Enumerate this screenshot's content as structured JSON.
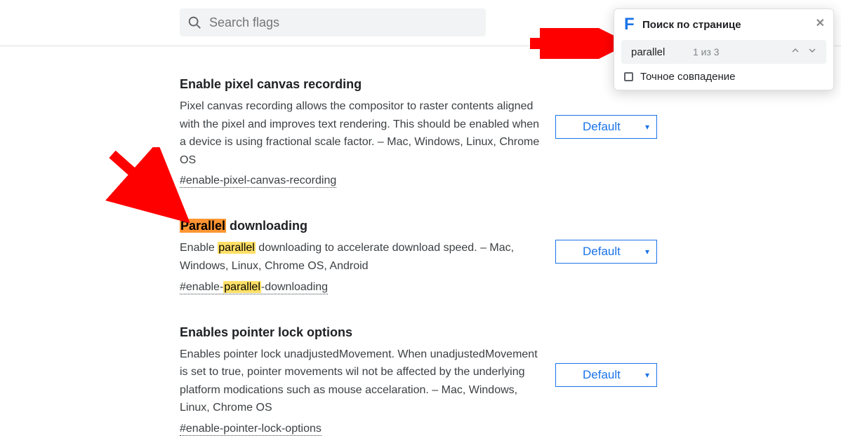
{
  "search": {
    "placeholder": "Search flags"
  },
  "find_panel": {
    "title": "Поиск по странице",
    "input_value": "parallel",
    "count_text": "1 из 3",
    "exact_label": "Точное совпадение",
    "partial_letter": "F"
  },
  "flags": [
    {
      "title": "Enable pixel canvas recording",
      "desc": "Pixel canvas recording allows the compositor to raster contents aligned with the pixel and improves text rendering. This should be enabled when a device is using fractional scale factor. – Mac, Windows, Linux, Chrome OS",
      "hash": "#enable-pixel-canvas-recording",
      "select": "Default",
      "highlight": "none"
    },
    {
      "title_prefix": "",
      "title_hl": "Parallel",
      "title_rest": " downloading",
      "desc_before": "Enable ",
      "desc_hl": "parallel",
      "desc_after": " downloading to accelerate download speed. – Mac, Windows, Linux, Chrome OS, Android",
      "hash_before": "#enable-",
      "hash_hl": "parallel",
      "hash_after": "-downloading",
      "select": "Default",
      "highlight": "active"
    },
    {
      "title": "Enables pointer lock options",
      "desc": "Enables pointer lock unadjustedMovement. When unadjustedMovement is set to true, pointer movements wil not be affected by the underlying platform modications such as mouse accelaration. – Mac, Windows, Linux, Chrome OS",
      "hash": "#enable-pointer-lock-options",
      "select": "Default",
      "highlight": "none"
    }
  ]
}
